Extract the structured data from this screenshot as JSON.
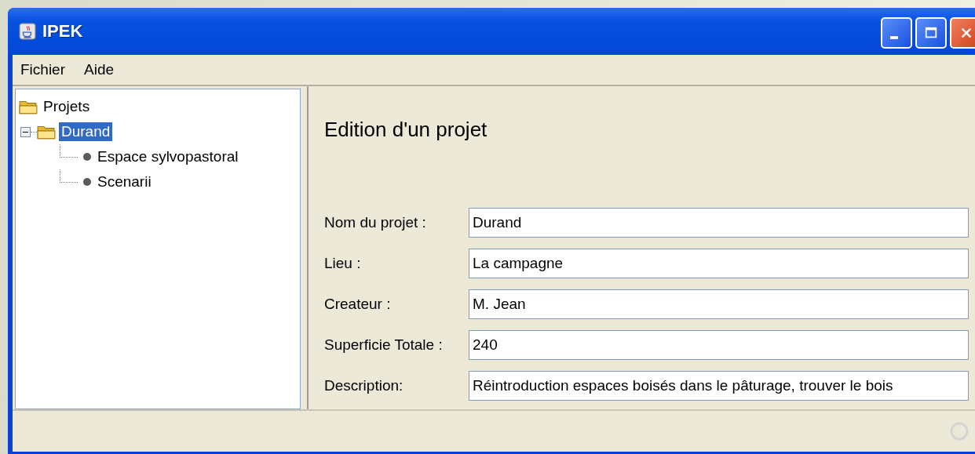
{
  "window": {
    "title": "IPEK"
  },
  "menu": [
    "Fichier",
    "Aide"
  ],
  "tree": {
    "label": "Projets",
    "selected": false,
    "children": [
      {
        "label": "Durand",
        "selected": true,
        "expanded": true,
        "children": [
          {
            "label": "Espace sylvopastoral",
            "selected": false
          },
          {
            "label": "Scenarii",
            "selected": false
          }
        ]
      }
    ]
  },
  "form": {
    "title": "Edition d'un projet",
    "fields": [
      {
        "label": "Nom du projet :",
        "value": "Durand"
      },
      {
        "label": "Lieu :",
        "value": "La campagne"
      },
      {
        "label": "Createur :",
        "value": "M. Jean"
      },
      {
        "label": "Superficie Totale :",
        "value": "240"
      },
      {
        "label": "Description:",
        "value": "Réintroduction espaces boisés dans le pâturage, trouver le bois"
      }
    ]
  }
}
